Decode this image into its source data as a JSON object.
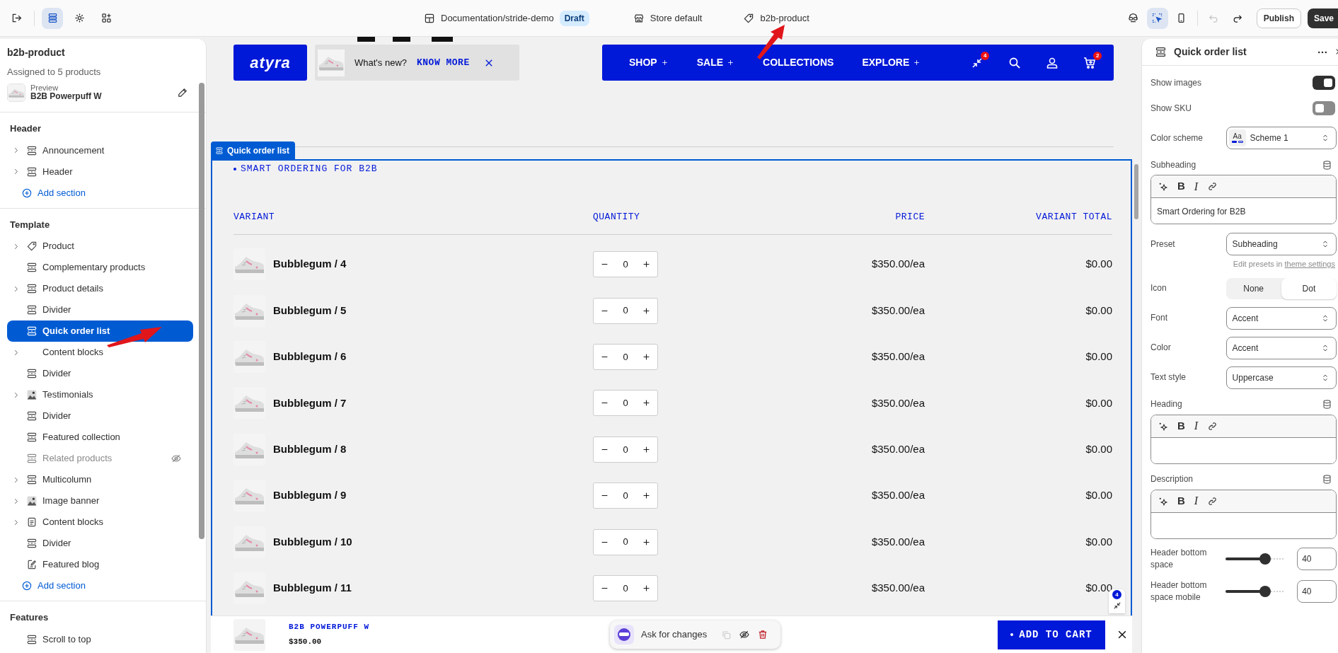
{
  "topbar": {
    "left_tools": [
      {
        "kind": "sections",
        "selected": true
      },
      {
        "kind": "settings",
        "selected": false
      },
      {
        "kind": "apps",
        "selected": false
      }
    ],
    "theme": {
      "label": "Documentation/stride-demo",
      "badge": "Draft"
    },
    "store": {
      "label": "Store default"
    },
    "template": {
      "label": "b2b-product"
    },
    "view_tools": [
      {
        "kind": "assistant",
        "selected": false
      },
      {
        "kind": "inspector",
        "selected": true
      },
      {
        "kind": "mobile",
        "selected": false
      }
    ],
    "history": [
      {
        "kind": "undo",
        "disabled": true
      },
      {
        "kind": "redo",
        "disabled": false
      }
    ],
    "buttons": [
      {
        "kind": "secondary",
        "label": "Publish"
      },
      {
        "kind": "primary",
        "label": "Save"
      }
    ]
  },
  "sidebar": {
    "title": "b2b-product",
    "subtitle": "Assigned to 5 products",
    "preview_label": "Preview",
    "preview_product": "B2B Powerpuff W",
    "groups": [
      {
        "title": "Header",
        "add_label": "Add section",
        "items": [
          {
            "label": "Announcement",
            "kind": "section",
            "expandable": true,
            "selected": false,
            "hidden": false
          },
          {
            "label": "Header",
            "kind": "section",
            "expandable": true,
            "selected": false,
            "hidden": false
          }
        ]
      },
      {
        "title": "Template",
        "add_label": "Add section",
        "items": [
          {
            "label": "Product",
            "kind": "tag",
            "expandable": true,
            "selected": false,
            "hidden": false
          },
          {
            "label": "Complementary products",
            "kind": "section",
            "expandable": false,
            "selected": false,
            "hidden": false
          },
          {
            "label": "Product details",
            "kind": "section",
            "expandable": true,
            "selected": false,
            "hidden": false
          },
          {
            "label": "Divider",
            "kind": "section",
            "expandable": false,
            "selected": false,
            "hidden": false
          },
          {
            "label": "Quick order list",
            "kind": "section",
            "expandable": false,
            "selected": true,
            "hidden": false
          },
          {
            "label": "Content blocks",
            "kind": "plain",
            "expandable": true,
            "selected": false,
            "hidden": false
          },
          {
            "label": "Divider",
            "kind": "section",
            "expandable": false,
            "selected": false,
            "hidden": false
          },
          {
            "label": "Testimonials",
            "expandable": true,
            "selected": false,
            "hidden": false
          },
          {
            "label": "Divider",
            "kind": "section",
            "expandable": false,
            "selected": false,
            "hidden": false
          },
          {
            "label": "Featured collection",
            "kind": "section",
            "expandable": false,
            "selected": false,
            "hidden": false
          },
          {
            "label": "Related products",
            "kind": "section",
            "expandable": false,
            "selected": false,
            "hidden": true
          },
          {
            "label": "Multicolumn",
            "kind": "section",
            "expandable": true,
            "selected": false,
            "hidden": false
          },
          {
            "label": "Image banner",
            "expandable": true,
            "selected": false,
            "hidden": false
          },
          {
            "label": "Content blocks",
            "kind": "doc",
            "expandable": true,
            "selected": false,
            "hidden": false
          },
          {
            "label": "Divider",
            "kind": "section",
            "expandable": false,
            "selected": false,
            "hidden": false
          },
          {
            "label": "Featured blog",
            "kind": "note",
            "expandable": false,
            "selected": false,
            "hidden": false
          }
        ]
      },
      {
        "title": "Features",
        "items": [
          {
            "label": "Scroll to top",
            "kind": "section",
            "expandable": false,
            "selected": false,
            "hidden": false
          }
        ]
      }
    ]
  },
  "preview": {
    "logo": "atyra",
    "announcement": {
      "text": "What's new?",
      "link": "KNOW MORE"
    },
    "nav": [
      {
        "label": "SHOP",
        "expandable": true
      },
      {
        "label": "SALE",
        "expandable": true
      },
      {
        "label": "COLLECTIONS",
        "expandable": false
      },
      {
        "label": "EXPLORE",
        "expandable": true
      }
    ],
    "header_icons": [
      {
        "kind": "compare",
        "badge": "4"
      },
      {
        "kind": "search"
      },
      {
        "kind": "account"
      },
      {
        "kind": "cart",
        "badge": "2"
      }
    ],
    "section_tag": "Quick order list",
    "subheading": {
      "text": "SMART ORDERING FOR B2B",
      "dot": true
    },
    "table": {
      "columns": [
        "VARIANT",
        "QUANTITY",
        "PRICE",
        "VARIANT TOTAL"
      ],
      "rows": [
        {
          "variant": "Bubblegum / 4",
          "quantity": "0",
          "price": "$350.00/ea",
          "total": "$0.00"
        },
        {
          "variant": "Bubblegum / 5",
          "quantity": "0",
          "price": "$350.00/ea",
          "total": "$0.00"
        },
        {
          "variant": "Bubblegum / 6",
          "quantity": "0",
          "price": "$350.00/ea",
          "total": "$0.00"
        },
        {
          "variant": "Bubblegum / 7",
          "quantity": "0",
          "price": "$350.00/ea",
          "total": "$0.00"
        },
        {
          "variant": "Bubblegum / 8",
          "quantity": "0",
          "price": "$350.00/ea",
          "total": "$0.00"
        },
        {
          "variant": "Bubblegum / 9",
          "quantity": "0",
          "price": "$350.00/ea",
          "total": "$0.00"
        },
        {
          "variant": "Bubblegum / 10",
          "quantity": "0",
          "price": "$350.00/ea",
          "total": "$0.00"
        },
        {
          "variant": "Bubblegum / 11",
          "quantity": "0",
          "price": "$350.00/ea",
          "total": "$0.00"
        }
      ]
    },
    "floating_badge": "4",
    "sticky_bar": {
      "product": "B2B POWERPUFF W",
      "price": "$350.00",
      "ask": "Ask for changes",
      "add_to_cart": "ADD TO CART",
      "dot": true
    }
  },
  "settings_panel": {
    "title": "Quick order list",
    "settings": [
      {
        "kind": "toggle",
        "label": "Show images",
        "on": true
      },
      {
        "kind": "toggle",
        "label": "Show SKU",
        "on": false
      },
      {
        "kind": "scheme",
        "label": "Color scheme",
        "swatch": "Aa",
        "value": "Scheme 1"
      },
      {
        "kind": "richtext",
        "label": "Subheading",
        "bold": "B",
        "italic": "I",
        "value": "Smart Ordering for B2B"
      },
      {
        "kind": "select",
        "label": "Preset",
        "value": "Subheading",
        "help": "Edit presets in",
        "help_link": "theme settings"
      },
      {
        "kind": "segmented",
        "label": "Icon",
        "options": [
          {
            "label": "None",
            "selected": false
          },
          {
            "label": "Dot",
            "selected": true
          }
        ]
      },
      {
        "kind": "select",
        "label": "Font",
        "value": "Accent"
      },
      {
        "kind": "select",
        "label": "Color",
        "value": "Accent"
      },
      {
        "kind": "select",
        "label": "Text style",
        "value": "Uppercase"
      },
      {
        "kind": "richtext",
        "label": "Heading",
        "bold": "B",
        "italic": "I"
      },
      {
        "kind": "richtext",
        "label": "Description",
        "bold": "B",
        "italic": "I"
      },
      {
        "kind": "range",
        "label": "Header bottom space",
        "level": 0.72,
        "value": "40"
      },
      {
        "kind": "range",
        "label": "Header bottom space mobile",
        "level": 0.72,
        "value": "40"
      }
    ]
  }
}
